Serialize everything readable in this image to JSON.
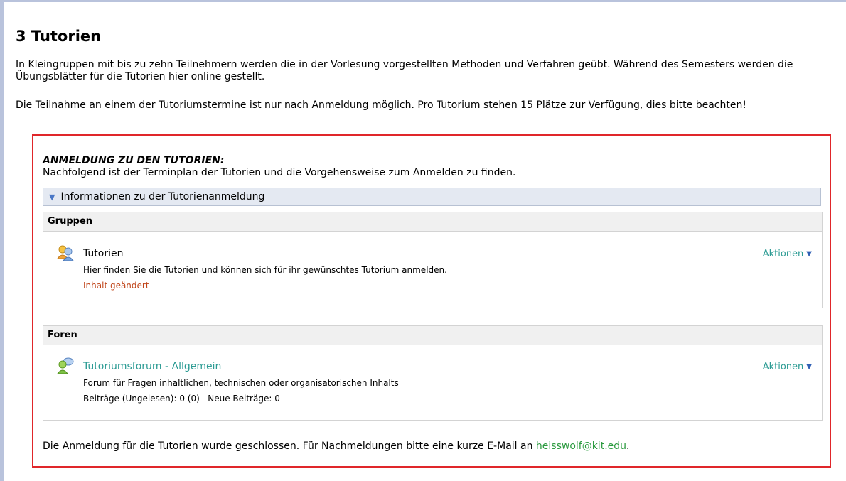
{
  "heading": "3 Tutorien",
  "intro": "In Kleingruppen mit bis zu zehn Teilnehmern werden die in der Vorlesung vorgestellten Methoden und Verfahren geübt. Während des Semesters werden die Übungsblätter für die Tutorien hier online gestellt.",
  "participation": "Die Teilnahme an einem der Tutoriumstermine ist nur nach Anmeldung möglich. Pro Tutorium stehen 15 Plätze zur Verfügung, dies bitte beachten!",
  "registration_box": {
    "title": "ANMELDUNG ZU DEN TUTORIEN:",
    "subtitle": "Nachfolgend ist der Terminplan der Tutorien und die Vorgehensweise zum Anmelden zu finden.",
    "accordion_label": "Informationen zu der Tutorienanmeldung",
    "groups": {
      "header": "Gruppen",
      "item": {
        "title": "Tutorien",
        "description": "Hier finden Sie die Tutorien und können sich für ihr gewünschtes Tutorium anmelden.",
        "status": "Inhalt geändert",
        "actions_label": "Aktionen",
        "icon": "group-icon"
      }
    },
    "forums": {
      "header": "Foren",
      "item": {
        "title": "Tutoriumsforum - Allgemein",
        "description": "Forum für Fragen inhaltlichen, technischen oder organisatorischen Inhalts",
        "posts_label": "Beiträge (Ungelesen): 0 (0)",
        "new_posts_label": "Neue Beiträge: 0",
        "actions_label": "Aktionen",
        "icon": "forum-icon"
      }
    },
    "closing_note_prefix": "Die Anmeldung für die Tutorien wurde geschlossen. Für Nachmeldungen bitte eine kurze E-Mail an",
    "email": "heisswolf@kit.edu",
    "closing_note_suffix": "."
  },
  "colors": {
    "border_red": "#e0262a",
    "link_teal": "#2b9b93",
    "changed_orange": "#c0451a",
    "mail_green": "#2a9a3e",
    "accordion_bg": "#e4e9f2"
  }
}
